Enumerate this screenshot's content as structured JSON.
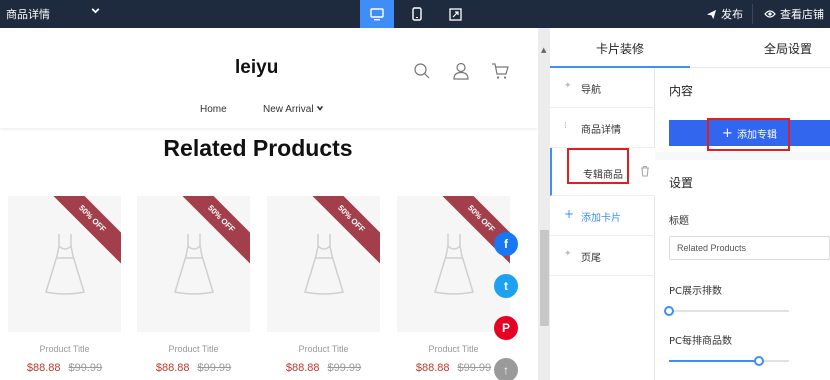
{
  "topbar": {
    "page_select": "商品详情",
    "publish_label": "发布",
    "view_store_label": "查看店铺",
    "devices": [
      "desktop-icon",
      "mobile-icon",
      "fullscreen-icon"
    ],
    "active_device": "desktop"
  },
  "preview": {
    "logo": "leiyu",
    "nav": [
      "Home",
      "New Arrival"
    ],
    "section_title": "Related Products",
    "products": [
      {
        "badge": "50% OFF",
        "title": "Product Title",
        "price": "$88.88",
        "old_price": "$99.99"
      },
      {
        "badge": "50% OFF",
        "title": "Product Title",
        "price": "$88.88",
        "old_price": "$99.99"
      },
      {
        "badge": "50% OFF",
        "title": "Product Title",
        "price": "$88.88",
        "old_price": "$99.99"
      },
      {
        "badge": "50% OFF",
        "title": "Product Title",
        "price": "$88.88",
        "old_price": "$99.99"
      }
    ],
    "social": [
      {
        "name": "facebook",
        "glyph": "f",
        "color": "#1877f2"
      },
      {
        "name": "twitter",
        "glyph": "t",
        "color": "#1da1f2"
      },
      {
        "name": "pinterest",
        "glyph": "P",
        "color": "#e60023"
      },
      {
        "name": "scroll-top",
        "glyph": "↑",
        "color": "#9a9a9a"
      }
    ]
  },
  "right_panel": {
    "tabs": [
      "卡片装修",
      "全局设置"
    ],
    "active_tab": "卡片装修",
    "nav_items": [
      {
        "icon": "pin-icon",
        "label": "导航"
      },
      {
        "icon": "drag-icon",
        "label": "商品详情"
      },
      {
        "icon": "",
        "label": "专辑商品"
      },
      {
        "icon": "plus-icon",
        "label": "添加卡片"
      },
      {
        "icon": "pin-icon",
        "label": "页尾"
      }
    ],
    "active_nav": "专辑商品",
    "content_title": "内容",
    "add_album_button": "添加专辑",
    "settings_title": "设置",
    "title_label": "标题",
    "title_value": "Related Products",
    "pc_rows_label": "PC展示排数",
    "pc_rows_value": 0,
    "pc_per_row_label": "PC每排商品数",
    "pc_per_row_fraction": 0.75,
    "accent_color": "#3f8ef7",
    "button_color": "#3366ee",
    "highlight_color": "#e02020"
  }
}
